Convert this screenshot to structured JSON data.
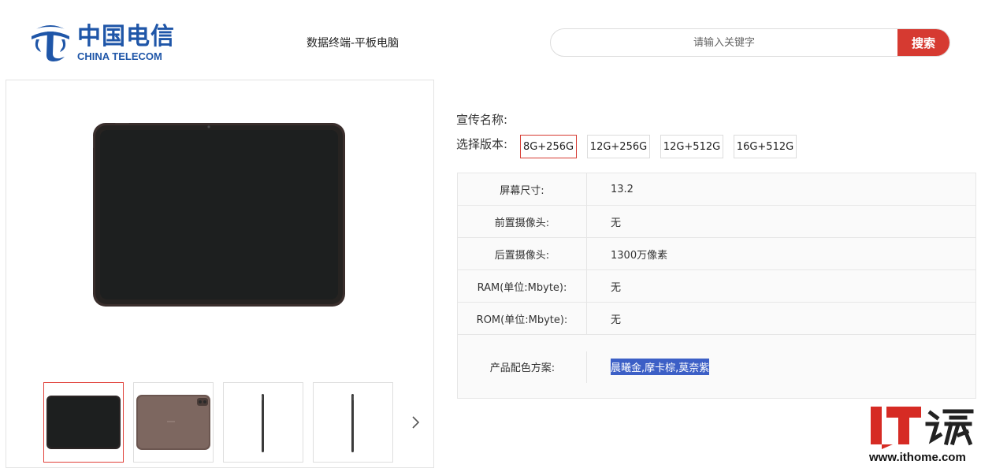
{
  "header": {
    "logo_cn": "中国电信",
    "logo_en": "CHINA TELECOM",
    "page_title": "数据终端-平板电脑",
    "search": {
      "placeholder": "请输入关键字",
      "button_label": "搜索"
    }
  },
  "colors": {
    "brand_blue": "#1f56a8",
    "accent_red": "#d63a31",
    "highlight_blue": "#3c5fc6"
  },
  "gallery": {
    "thumbnails": [
      "front-black",
      "back-brown",
      "side-1",
      "side-2"
    ],
    "active_index": 0,
    "next_icon": "chevron-right-icon"
  },
  "details": {
    "promo_name_label": "宣传名称:",
    "version_label": "选择版本:",
    "versions": [
      "8G+256G",
      "12G+256G",
      "12G+512G",
      "16G+512G"
    ],
    "selected_version": "8G+256G",
    "specs": [
      {
        "key": "屏幕尺寸:",
        "value": "13.2"
      },
      {
        "key": "前置摄像头:",
        "value": "无"
      },
      {
        "key": "后置摄像头:",
        "value": "1300万像素"
      },
      {
        "key": "RAM(单位:Mbyte):",
        "value": "无"
      },
      {
        "key": "ROM(单位:Mbyte):",
        "value": "无"
      },
      {
        "key": "产品配色方案:",
        "value": "晨曦金,摩卡棕,莫奈紫"
      }
    ]
  },
  "watermark": {
    "logo_text": "IT之家",
    "url": "www.ithome.com"
  }
}
